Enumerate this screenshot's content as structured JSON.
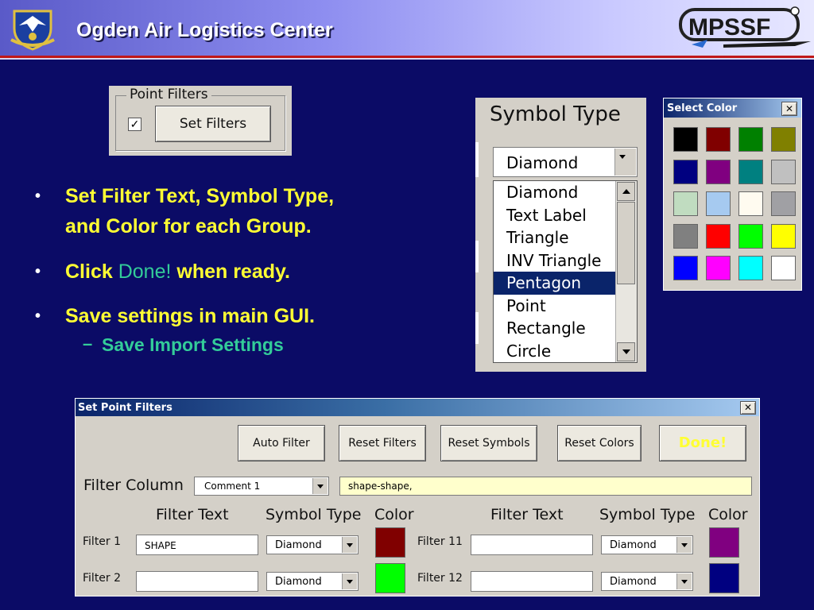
{
  "header": {
    "title": "Ogden Air Logistics Center",
    "logo_right_text": "MPSSF"
  },
  "bullets": [
    {
      "line1": "Set Filter Text, Symbol Type,",
      "line2": "and Color for each Group."
    },
    {
      "pre": "Click ",
      "highlight": "Done!",
      "post": " when ready."
    },
    {
      "line1": "Save settings in main GUI."
    }
  ],
  "sub_bullet": {
    "dash": "–",
    "text": "Save Import Settings"
  },
  "point_filters_panel": {
    "group_label": "Point Filters",
    "checkbox_checked": true,
    "button_label": "Set Filters"
  },
  "symbol_type_panel": {
    "title": "Symbol Type",
    "selected": "Diamond",
    "options": [
      "Diamond",
      "Text Label",
      "Triangle",
      "INV Triangle",
      "Pentagon",
      "Point",
      "Rectangle",
      "Circle"
    ],
    "highlighted": "Pentagon"
  },
  "select_color_dialog": {
    "title": "Select Color",
    "close_label": "✕",
    "colors": [
      "#000000",
      "#800000",
      "#008000",
      "#808000",
      "#000080",
      "#800080",
      "#008080",
      "#c0c0c0",
      "#c0dcc0",
      "#a6caf0",
      "#fffbf0",
      "#a0a0a4",
      "#808080",
      "#ff0000",
      "#00ff00",
      "#ffff00",
      "#0000ff",
      "#ff00ff",
      "#00ffff",
      "#ffffff"
    ]
  },
  "set_point_filters": {
    "title": "Set Point Filters",
    "close_label": "✕",
    "buttons": {
      "auto_filter": "Auto Filter",
      "reset_filters": "Reset Filters",
      "reset_symbols": "Reset Symbols",
      "reset_colors": "Reset Colors",
      "done": "Done!"
    },
    "filter_column_label": "Filter Column",
    "filter_column_value": "Comment 1",
    "filter_column_text": "shape-shape,",
    "col_headers": {
      "filter_text": "Filter Text",
      "symbol_type": "Symbol Type",
      "color": "Color"
    },
    "left_rows": [
      {
        "label": "Filter 1",
        "text": "SHAPE",
        "symbol": "Diamond",
        "color": "#800000"
      },
      {
        "label": "Filter 2",
        "text": "",
        "symbol": "Diamond",
        "color": "#00ff00"
      }
    ],
    "right_rows": [
      {
        "label": "Filter 11",
        "text": "",
        "symbol": "Diamond",
        "color": "#800080"
      },
      {
        "label": "Filter 12",
        "text": "",
        "symbol": "Diamond",
        "color": "#000080"
      }
    ]
  }
}
